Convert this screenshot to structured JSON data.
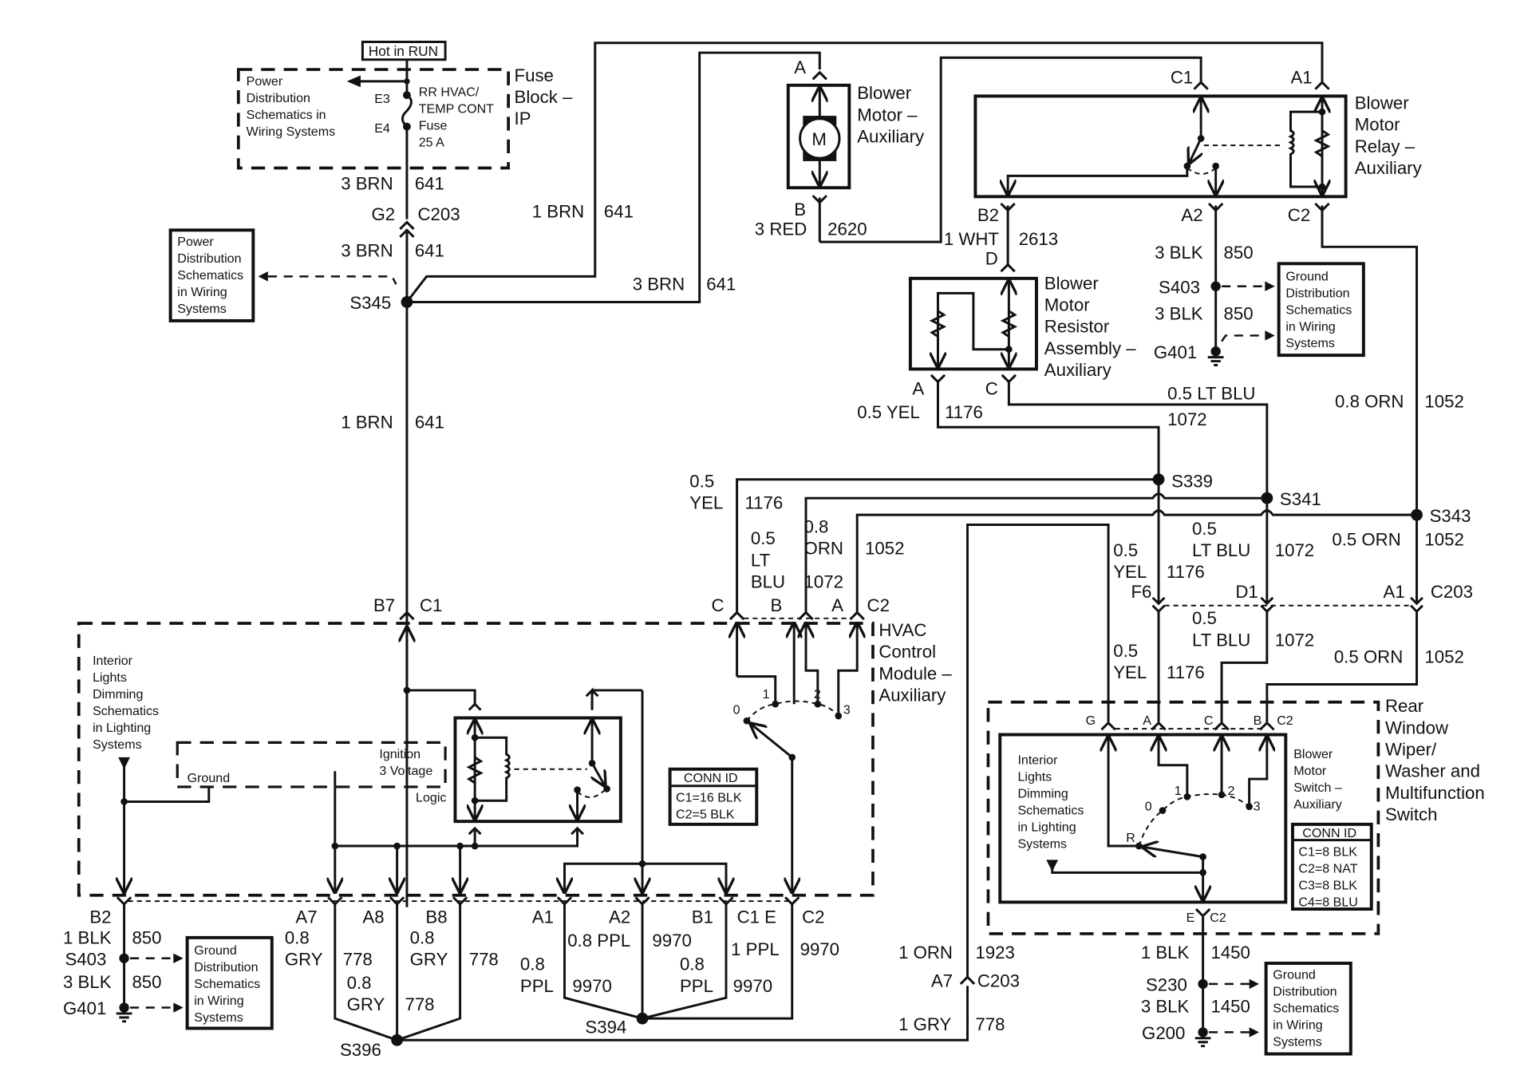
{
  "diagram": {
    "hot_in_run": "Hot in RUN",
    "fuse_block": {
      "title": [
        "Fuse",
        "Block –",
        "IP"
      ],
      "fuse_name": [
        "RR HVAC/",
        "TEMP CONT",
        "Fuse",
        "25 A"
      ],
      "pin_in": "E3",
      "pin_out": "E4",
      "power_ref": [
        "Power",
        "Distribution",
        "Schematics in",
        "Wiring Systems"
      ]
    },
    "power_ref_2": [
      "Power",
      "Distribution",
      "Schematics",
      "in Wiring",
      "Systems"
    ],
    "blower_motor": {
      "title": [
        "Blower",
        "Motor –",
        "Auxiliary"
      ],
      "symbol": "M",
      "pin_top": "A",
      "pin_bottom": "B"
    },
    "blower_relay": {
      "title": [
        "Blower",
        "Motor",
        "Relay –",
        "Auxiliary"
      ],
      "pins": {
        "c1": "C1",
        "a1": "A1",
        "b2": "B2",
        "a2": "A2",
        "c2": "C2"
      }
    },
    "resistor_assembly": {
      "title": [
        "Blower",
        "Motor",
        "Resistor",
        "Assembly –",
        "Auxiliary"
      ],
      "pins": {
        "d": "D",
        "a": "A",
        "c": "C"
      }
    },
    "hvac_module": {
      "title": [
        "HVAC",
        "Control",
        "Module –",
        "Auxiliary"
      ],
      "interior_ref": [
        "Interior",
        "Lights",
        "Dimming",
        "Schematics",
        "in Lighting",
        "Systems"
      ],
      "logic_ground": "Ground",
      "logic_ign": [
        "Ignition",
        "3 Voltage"
      ],
      "logic_label": "Logic",
      "switch_positions": [
        "0",
        "1",
        "2",
        "3"
      ],
      "conn_id_title": "CONN ID",
      "conn_id": [
        "C1=16 BLK",
        "C2=5 BLK"
      ],
      "top_pins": {
        "b7": "B7",
        "c1": "C1",
        "c": "C",
        "b": "B",
        "a": "A",
        "c2": "C2"
      },
      "bottom_pins": {
        "b2": "B2",
        "a7": "A7",
        "a8": "A8",
        "b8": "B8",
        "a1": "A1",
        "a2": "A2",
        "b1": "B1",
        "c1e": "C1 E",
        "c2": "C2"
      }
    },
    "rear_switch": {
      "title": [
        "Rear",
        "Window",
        "Wiper/",
        "Washer and",
        "Multifunction",
        "Switch"
      ],
      "sub_title": [
        "Blower",
        "Motor",
        "Switch –",
        "Auxiliary"
      ],
      "interior_ref": [
        "Interior",
        "Lights",
        "Dimming",
        "Schematics",
        "in Lighting",
        "Systems"
      ],
      "positions": [
        "R",
        "0",
        "1",
        "2",
        "3"
      ],
      "pins": {
        "g": "G",
        "a": "A",
        "c": "C",
        "b": "B",
        "c2": "C2",
        "e": "E",
        "c2b": "C2"
      },
      "conn_id_title": "CONN ID",
      "conn_id": [
        "C1=8 BLK",
        "C2=8 NAT",
        "C3=8 BLK",
        "C4=8 BLU"
      ]
    },
    "ground_ref": [
      "Ground",
      "Distribution",
      "Schematics",
      "in Wiring",
      "Systems"
    ],
    "splices": {
      "s345": "S345",
      "s403": "S403",
      "s339": "S339",
      "s341": "S341",
      "s343": "S343",
      "s396": "S396",
      "s394": "S394",
      "s230": "S230",
      "s403b": "S403"
    },
    "grounds": {
      "g401": "G401",
      "g401b": "G401",
      "g200": "G200"
    },
    "connectors": {
      "g2": "G2",
      "c203": "C203",
      "f6": "F6",
      "d1": "D1",
      "a1": "A1",
      "c203b": "C203",
      "a7": "A7",
      "c203c": "C203"
    },
    "wires": {
      "w1": {
        "color": "3 BRN",
        "circuit": "641"
      },
      "w2": {
        "color": "3 BRN",
        "circuit": "641"
      },
      "w3": {
        "color": "1 BRN",
        "circuit": "641"
      },
      "w4": {
        "color": "3 BRN",
        "circuit": "641"
      },
      "w5": {
        "color": "1 BRN",
        "circuit": "641"
      },
      "w6": {
        "color": "3 RED",
        "circuit": "2620"
      },
      "w7": {
        "color": "1 WHT",
        "circuit": "2613"
      },
      "w8": {
        "color": "3 BLK",
        "circuit": "850"
      },
      "w9": {
        "color": "3 BLK",
        "circuit": "850"
      },
      "w10": {
        "color": "0.5 YEL",
        "circuit": "1176"
      },
      "w11": {
        "color": "0.5 LT BLU",
        "circuit": "1072"
      },
      "w12": {
        "color": "0.8 ORN",
        "circuit": "1052"
      },
      "w13": {
        "color": [
          "0.5",
          "YEL"
        ],
        "circuit": "1176"
      },
      "w14": {
        "color": [
          "0.5",
          "LT",
          "BLU"
        ],
        "circuit": "1072"
      },
      "w15": {
        "color": [
          "0.8",
          "ORN"
        ],
        "circuit": "1052"
      },
      "w16": {
        "color": [
          "0.5",
          "YEL"
        ],
        "circuit": "1176"
      },
      "w17": {
        "color": [
          "0.5",
          "LT BLU"
        ],
        "circuit": "1072"
      },
      "w18": {
        "color": "0.5 ORN",
        "circuit": "1052"
      },
      "w19": {
        "color": [
          "0.5",
          "YEL"
        ],
        "circuit": "1176"
      },
      "w20": {
        "color": [
          "0.5",
          "LT BLU"
        ],
        "circuit": "1072"
      },
      "w21": {
        "color": "0.5 ORN",
        "circuit": "1052"
      },
      "w22": {
        "color": "1 BLK",
        "circuit": "850"
      },
      "w23": {
        "color": "3 BLK",
        "circuit": "850"
      },
      "w24": {
        "color": [
          "0.8",
          "GRY"
        ],
        "circuit": "778"
      },
      "w25": {
        "color": [
          "0.8",
          "GRY"
        ],
        "circuit": "778"
      },
      "w26": {
        "color": [
          "0.8",
          "GRY"
        ],
        "circuit": "778"
      },
      "w27": {
        "color": [
          "0.8",
          "PPL"
        ],
        "circuit": "9970"
      },
      "w28": {
        "color": "0.8 PPL",
        "circuit": "9970"
      },
      "w29": {
        "color": [
          "0.8",
          "PPL"
        ],
        "circuit": "9970"
      },
      "w30": {
        "color": "1 PPL",
        "circuit": "9970"
      },
      "w31": {
        "color": "1 ORN",
        "circuit": "1923"
      },
      "w32": {
        "color": "1 GRY",
        "circuit": "778"
      },
      "w33": {
        "color": "1 BLK",
        "circuit": "1450"
      },
      "w34": {
        "color": "3 BLK",
        "circuit": "1450"
      }
    }
  }
}
